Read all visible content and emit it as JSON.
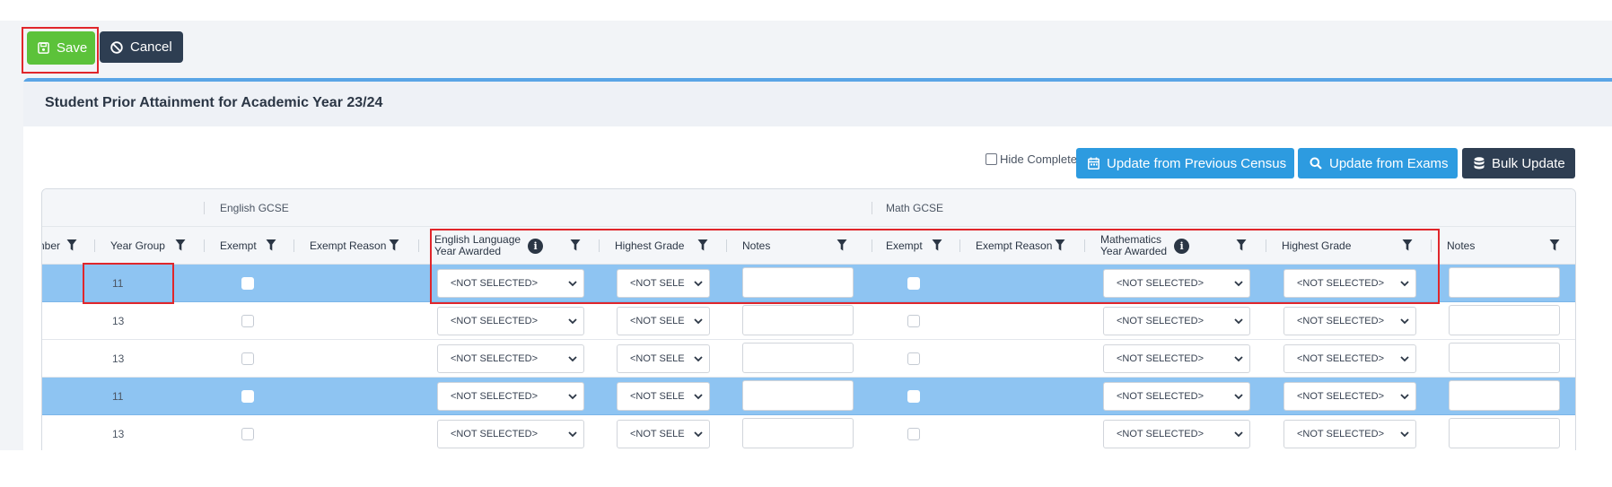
{
  "toolbar": {
    "save_label": "Save",
    "cancel_label": "Cancel"
  },
  "panel": {
    "title": "Student Prior Attainment for Academic Year 23/24"
  },
  "actions": {
    "hide_complete_label": "Hide Complete",
    "update_census_label": "Update from Previous Census",
    "update_exams_label": "Update from Exams",
    "bulk_update_label": "Bulk Update"
  },
  "grid": {
    "groups": {
      "english": "English GCSE",
      "math": "Math GCSE"
    },
    "columns": {
      "number_partial": "nber",
      "year_group": "Year Group",
      "exempt": "Exempt",
      "exempt_reason": "Exempt Reason",
      "english_year_awarded_line1": "English Language",
      "english_year_awarded_line2": "Year Awarded",
      "english_highest_grade": "Highest Grade",
      "english_notes": "Notes",
      "math_exempt": "Exempt",
      "math_exempt_reason": "Exempt Reason",
      "math_year_awarded_line1": "Mathematics",
      "math_year_awarded_line2": "Year Awarded",
      "math_highest_grade": "Highest Grade",
      "math_notes": "Notes"
    },
    "info_glyph": "i",
    "rows": [
      {
        "year_group": "11",
        "selected": true,
        "eng_year": "<NOT SELECTED>",
        "eng_grade": "<NOT SELE",
        "math_year": "<NOT SELECTED>",
        "math_grade": "<NOT SELECTED>"
      },
      {
        "year_group": "13",
        "selected": false,
        "eng_year": "<NOT SELECTED>",
        "eng_grade": "<NOT SELE",
        "math_year": "<NOT SELECTED>",
        "math_grade": "<NOT SELECTED>"
      },
      {
        "year_group": "13",
        "selected": false,
        "eng_year": "<NOT SELECTED>",
        "eng_grade": "<NOT SELE",
        "math_year": "<NOT SELECTED>",
        "math_grade": "<NOT SELECTED>"
      },
      {
        "year_group": "11",
        "selected": true,
        "eng_year": "<NOT SELECTED>",
        "eng_grade": "<NOT SELE",
        "math_year": "<NOT SELECTED>",
        "math_grade": "<NOT SELECTED>"
      },
      {
        "year_group": "13",
        "selected": false,
        "eng_year": "<NOT SELECTED>",
        "eng_grade": "<NOT SELE",
        "math_year": "<NOT SELECTED>",
        "math_grade": "<NOT SELECTED>"
      }
    ]
  },
  "icons": {
    "save": "floppy-icon",
    "cancel": "ban-icon",
    "census": "calendar-icon",
    "exams": "search-icon",
    "bulk": "database-icon",
    "filter": "filter-icon",
    "info": "info-icon",
    "chevron": "chevron-down-icon"
  },
  "colors": {
    "save_green": "#5cc23a",
    "dark_navy": "#2e3e52",
    "action_blue": "#2d9be0",
    "selected_row": "#8ec4f2",
    "highlight_red": "#e0262b",
    "panel_accent": "#5aa5e6"
  }
}
